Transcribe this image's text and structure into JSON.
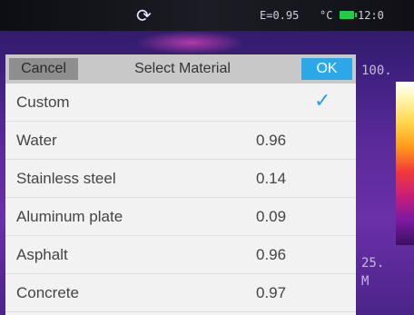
{
  "statusbar": {
    "refresh_icon": "refresh-icon",
    "emissivity": "E=0.95",
    "unit": "°C",
    "battery_icon": "battery-icon",
    "time": "12:0"
  },
  "dialog": {
    "cancel_label": "Cancel",
    "title": "Select Material",
    "ok_label": "OK",
    "items": [
      {
        "name": "Custom",
        "value": "",
        "selected": true
      },
      {
        "name": "Water",
        "value": "0.96"
      },
      {
        "name": "Stainless steel",
        "value": "0.14"
      },
      {
        "name": "Aluminum plate",
        "value": "0.09"
      },
      {
        "name": "Asphalt",
        "value": "0.96"
      },
      {
        "name": "Concrete",
        "value": "0.97"
      }
    ]
  },
  "scale": {
    "max": "100.",
    "min": "25.",
    "mode": "M"
  },
  "colors": {
    "accent": "#2aa8e8",
    "check": "#2a9ee0",
    "battery": "#22cc44"
  }
}
